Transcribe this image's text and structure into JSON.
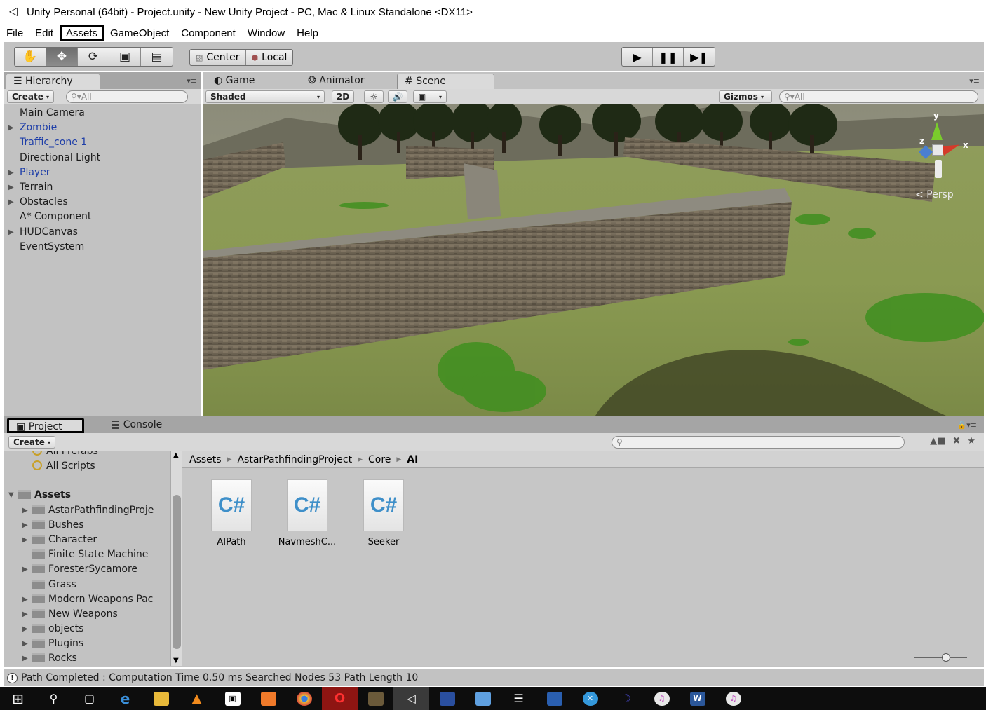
{
  "window": {
    "title": "Unity Personal (64bit) - Project.unity - New Unity Project - PC, Mac & Linux Standalone <DX11>"
  },
  "menu": [
    "File",
    "Edit",
    "Assets",
    "GameObject",
    "Component",
    "Window",
    "Help"
  ],
  "toolbar": {
    "tools": [
      "hand-icon",
      "move-icon",
      "rotate-icon",
      "scale-icon",
      "rect-icon"
    ],
    "active_tool": "move-icon",
    "pivot_label": "Center",
    "space_label": "Local",
    "play_icons": [
      "play-icon",
      "pause-icon",
      "step-icon"
    ]
  },
  "hierarchy": {
    "tab": "Hierarchy",
    "create_label": "Create",
    "search_placeholder": "All",
    "items": [
      {
        "label": "Main Camera",
        "arrow": false,
        "prefab": false
      },
      {
        "label": "Zombie",
        "arrow": true,
        "prefab": true
      },
      {
        "label": "Traffic_cone 1",
        "arrow": false,
        "prefab": true
      },
      {
        "label": "Directional Light",
        "arrow": false,
        "prefab": false
      },
      {
        "label": "Player",
        "arrow": true,
        "prefab": true
      },
      {
        "label": "Terrain",
        "arrow": true,
        "prefab": false
      },
      {
        "label": "Obstacles",
        "arrow": true,
        "prefab": false
      },
      {
        "label": "A* Component",
        "arrow": false,
        "prefab": false
      },
      {
        "label": "HUDCanvas",
        "arrow": true,
        "prefab": false
      },
      {
        "label": "EventSystem",
        "arrow": false,
        "prefab": false
      }
    ]
  },
  "scene": {
    "tabs": {
      "game": "Game",
      "animator": "Animator",
      "scene": "Scene"
    },
    "shading": "Shaded",
    "mode_2d": "2D",
    "gizmos_label": "Gizmos",
    "search_placeholder": "All",
    "persp_label": "Persp",
    "axis_labels": {
      "y": "y",
      "x": "x",
      "z": "z"
    }
  },
  "project": {
    "tabs": {
      "project": "Project",
      "console": "Console"
    },
    "create_label": "Create",
    "favorites": [
      "All Prefabs",
      "All Scripts"
    ],
    "assets_root": "Assets",
    "folders": [
      {
        "label": "AstarPathfindingProje",
        "arrow": true
      },
      {
        "label": "Bushes",
        "arrow": true
      },
      {
        "label": "Character",
        "arrow": true
      },
      {
        "label": "Finite State Machine",
        "arrow": false
      },
      {
        "label": "ForesterSycamore",
        "arrow": true
      },
      {
        "label": "Grass",
        "arrow": false
      },
      {
        "label": "Modern Weapons Pac",
        "arrow": true
      },
      {
        "label": "New Weapons",
        "arrow": true
      },
      {
        "label": "objects",
        "arrow": true
      },
      {
        "label": "Plugins",
        "arrow": true
      },
      {
        "label": "Rocks",
        "arrow": true
      }
    ],
    "breadcrumb": [
      "Assets",
      "AstarPathfindingProject",
      "Core",
      "AI"
    ],
    "assets": [
      {
        "label": "AIPath",
        "icon": "C#"
      },
      {
        "label": "NavmeshC...",
        "icon": "C#"
      },
      {
        "label": "Seeker",
        "icon": "C#"
      }
    ]
  },
  "status": {
    "message": "Path Completed : Computation Time 0.50 ms Searched Nodes 53 Path Length 10"
  },
  "taskbar": {
    "icons": [
      "windows-start-icon",
      "search-icon",
      "task-view-icon",
      "edge-icon",
      "file-explorer-icon",
      "vlc-icon",
      "store-icon",
      "paint-icon",
      "chrome-icon",
      "opera-icon",
      "package-icon",
      "unity-icon",
      "dosbox-icon",
      "cube-icon",
      "link-icon",
      "virtualbox-icon",
      "xamarin-icon",
      "eclipse-icon",
      "itunes-icon",
      "word-icon",
      "itunes-icon-2"
    ],
    "word_label": "W"
  },
  "colors": {
    "prefab_text": "#1e3ea8",
    "panel_bg": "#c2c2c2",
    "taskbar_bg": "#0d0d0d"
  }
}
